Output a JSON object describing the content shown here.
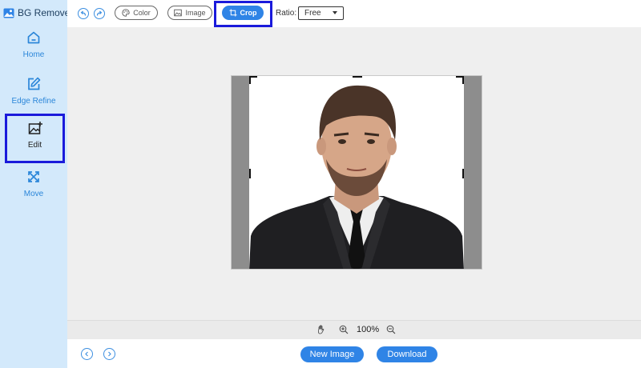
{
  "app": {
    "name": "BG Remover"
  },
  "sidebar": {
    "items": [
      {
        "label": "Home",
        "icon": "home-icon"
      },
      {
        "label": "Edge Refine",
        "icon": "edit-pen-icon"
      },
      {
        "label": "Edit",
        "icon": "image-edit-icon",
        "active": true
      },
      {
        "label": "Move",
        "icon": "move-arrows-icon"
      }
    ]
  },
  "toolbar": {
    "undo_icon": "undo-icon",
    "redo_icon": "redo-icon",
    "color_label": "Color",
    "image_label": "Image",
    "crop_label": "Crop",
    "ratio_label": "Ratio:",
    "ratio_value": "Free"
  },
  "zoom": {
    "value": "100%"
  },
  "footer": {
    "new_image_label": "New Image",
    "download_label": "Download"
  },
  "colors": {
    "accent": "#2f84e6",
    "sidebar_bg": "#d3e9fb",
    "highlight": "#1a1adb"
  }
}
